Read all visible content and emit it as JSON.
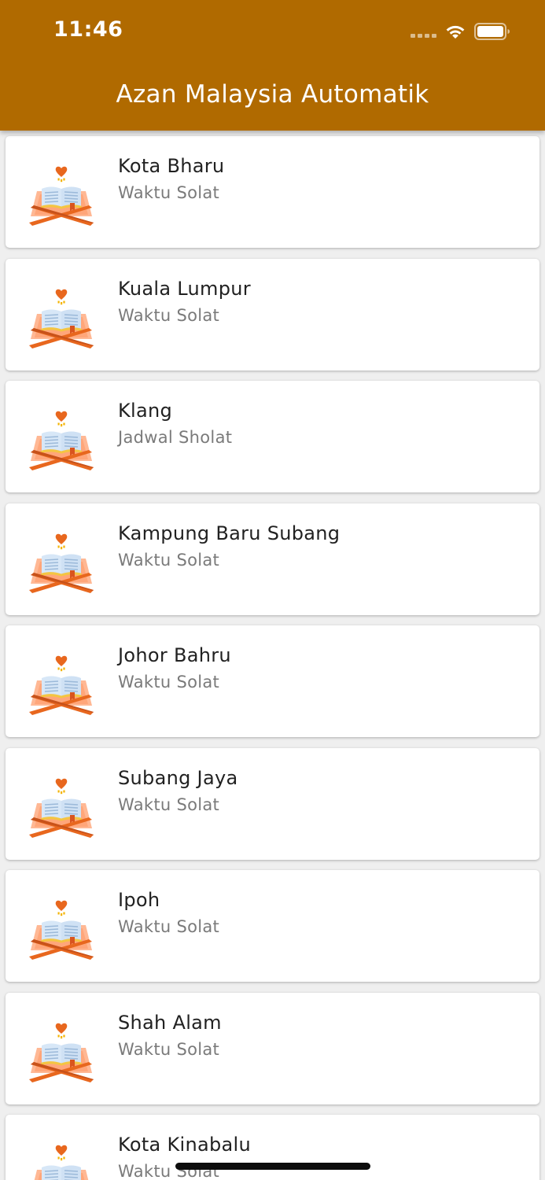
{
  "status_bar": {
    "time": "11:46",
    "wifi_icon": "wifi-icon",
    "battery_icon": "battery-icon"
  },
  "app_bar": {
    "title": "Azan Malaysia Automatik",
    "background_color": "#b06a00"
  },
  "list": {
    "item_icon": "quran-stand-icon",
    "items": [
      {
        "title": "Kota Bharu",
        "subtitle": "Waktu Solat"
      },
      {
        "title": "Kuala Lumpur",
        "subtitle": "Waktu Solat"
      },
      {
        "title": "Klang",
        "subtitle": "Jadwal Sholat"
      },
      {
        "title": "Kampung Baru Subang",
        "subtitle": "Waktu Solat"
      },
      {
        "title": "Johor Bahru",
        "subtitle": "Waktu Solat"
      },
      {
        "title": "Subang Jaya",
        "subtitle": "Waktu Solat"
      },
      {
        "title": "Ipoh",
        "subtitle": "Waktu Solat"
      },
      {
        "title": "Shah Alam",
        "subtitle": "Waktu Solat"
      },
      {
        "title": "Kota Kinabalu",
        "subtitle": "Waktu Solat"
      }
    ]
  }
}
